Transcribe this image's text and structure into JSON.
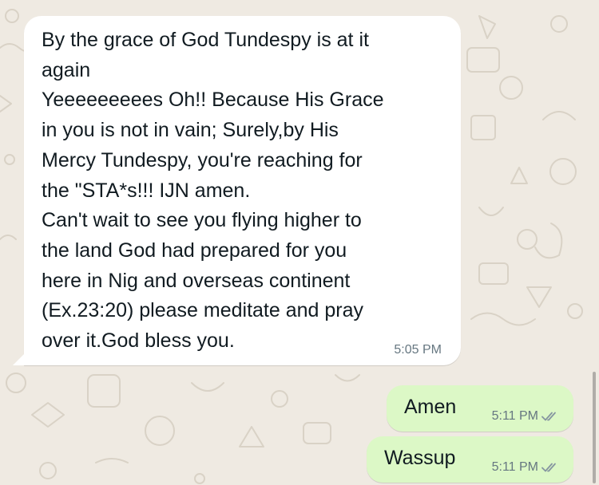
{
  "chat": {
    "incoming_message": {
      "text": "By the grace of God Tundespy is at it\nagain\nYeeeeeeeees Oh!! Because His Grace\nin you is not in vain; Surely,by His\nMercy Tundespy, you're reaching for\nthe \"STA*s!!! IJN amen.\nCan't wait to see you flying higher to\nthe land God had prepared for you\nhere in Nig and overseas continent\n(Ex.23:20) please meditate and pray\nover it.God bless you.",
      "time": "5:05 PM"
    },
    "outgoing_messages": [
      {
        "text": "Amen",
        "time": "5:11 PM",
        "status_icon": "double-check-read-icon"
      },
      {
        "text": "Wassup",
        "time": "5:11 PM",
        "status_icon": "double-check-read-icon"
      }
    ]
  },
  "colors": {
    "background": "#efeae2",
    "incoming_bubble": "#ffffff",
    "outgoing_bubble": "#dcf8c6",
    "timestamp": "#667781",
    "ticks": "#8696a0"
  }
}
